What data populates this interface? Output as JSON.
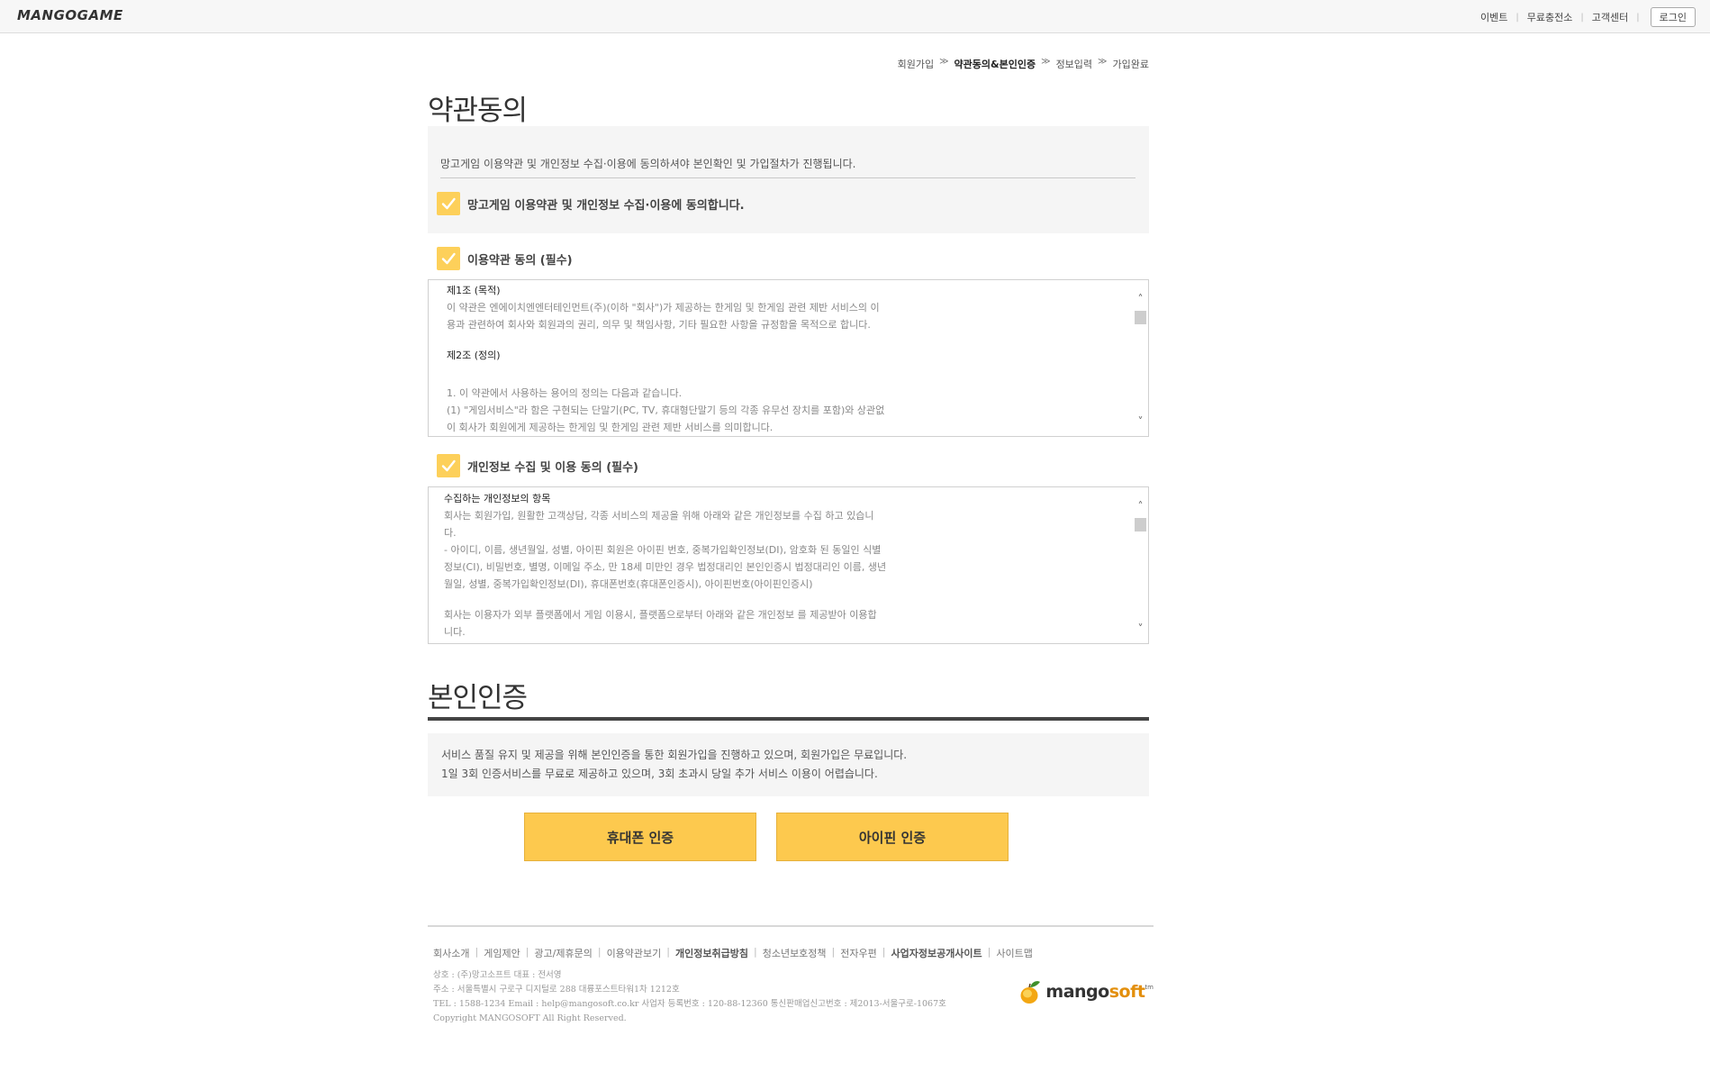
{
  "header": {
    "logo": "MANGOGAME",
    "nav": [
      "이벤트",
      "무료충전소",
      "고객센터"
    ],
    "login": "로그인"
  },
  "steps": {
    "items": [
      "회원가입",
      "약관동의&본인인증",
      "정보입력",
      "가입완료"
    ],
    "active_index": 1,
    "arrow": "≫"
  },
  "terms_section": {
    "title": "약관동의",
    "intro": "망고게임 이용약관 및 개인정보 수집·이용에 동의하셔야 본인확인 및 가입절차가 진행됩니다.",
    "agree_all_label": "망고게임 이용약관 및 개인정보 수집·이용에 동의합니다.",
    "agree_all_checked": true
  },
  "tos": {
    "label": "이용약관 동의 (필수)",
    "checked": true,
    "lines": [
      "제1조 (목적)",
      "이 약관은 엔에이치엔엔터테인먼트(주)(이하 \"회사\")가 제공하는 한게임 및 한게임 관련 제반 서비스의 이",
      "용과 관련하여 회사와 회원과의 권리, 의무 및 책임사항, 기타 필요한 사항을 규정함을 목적으로 합니다.",
      "제2조 (정의)",
      "1. 이 약관에서 사용하는 용어의 정의는 다음과 같습니다.",
      "(1) \"게임서비스\"라 함은 구현되는 단말기(PC, TV, 휴대형단말기 등의 각종 유무선 장치를 포함)와 상관없",
      "이 회사가 회원에게 제공하는 한게임 및 한게임 관련 제반 서비스를 의미합니다."
    ]
  },
  "privacy": {
    "label": "개인정보 수집 및 이용 동의 (필수)",
    "checked": true,
    "lines": [
      "수집하는 개인정보의 항목",
      "회사는 회원가입, 원활한 고객상담, 각종 서비스의 제공을 위해 아래와 같은 개인정보를 수집 하고 있습니",
      "다.",
      "- 아이디, 이름, 생년월일, 성별, 아이핀 회원은 아이핀 번호, 중복가입확인정보(DI), 암호화 된 동일인 식별",
      "정보(CI), 비밀번호, 별명, 이메일 주소, 만 18세 미만인 경우 법정대리인 본인인증시 법정대리인 이름, 생년",
      "월일, 성별, 중복가입확인정보(DI), 휴대폰번호(휴대폰인증시), 아이핀번호(아이핀인증시)",
      "회사는 이용자가 외부 플랫폼에서 게임 이용시, 플랫폼으로부터 아래와 같은 개인정보 를 제공받아 이용합",
      "니다."
    ]
  },
  "verify_section": {
    "title": "본인인증",
    "line1": "서비스 품질 유지 및 제공을 위해 본인인증을 통한 회원가입을 진행하고 있으며, 회원가입은 무료입니다.",
    "line2": "1일 3회 인증서비스를 무료로 제공하고 있으며, 3회 초과시 당일 추가 서비스 이용이 어렵습니다.",
    "phone_button": "휴대폰 인증",
    "ipin_button": "아이핀 인증"
  },
  "footer": {
    "links": [
      {
        "label": "회사소개",
        "bold": false
      },
      {
        "label": "게임제안",
        "bold": false
      },
      {
        "label": "광고/제휴문의",
        "bold": false
      },
      {
        "label": "이용약관보기",
        "bold": false
      },
      {
        "label": "개인정보취급방침",
        "bold": true
      },
      {
        "label": "청소년보호정책",
        "bold": false
      },
      {
        "label": "전자우편",
        "bold": false
      },
      {
        "label": "사업자정보공개사이트",
        "bold": true
      },
      {
        "label": "사이트맵",
        "bold": false
      }
    ],
    "info": [
      "상호 : (주)망고소프트 대표 : 전서영",
      "주소 : 서울특별시 구로구 디지털로 288 대륭포스트타워1차 1212호",
      "TEL : 1588-1234 Email : help@mangosoft.co.kr 사업자 등록번호 : 120-88-12360 통신판매업신고번호 : 제2013-서울구로-1067호",
      "Copyright MANGOSOFT All Right Reserved."
    ],
    "logo_main": "mango",
    "logo_accent": "soft",
    "logo_tm": "tm"
  },
  "colors": {
    "accent": "#fdc94e",
    "checkbox": "#fdd05a"
  }
}
